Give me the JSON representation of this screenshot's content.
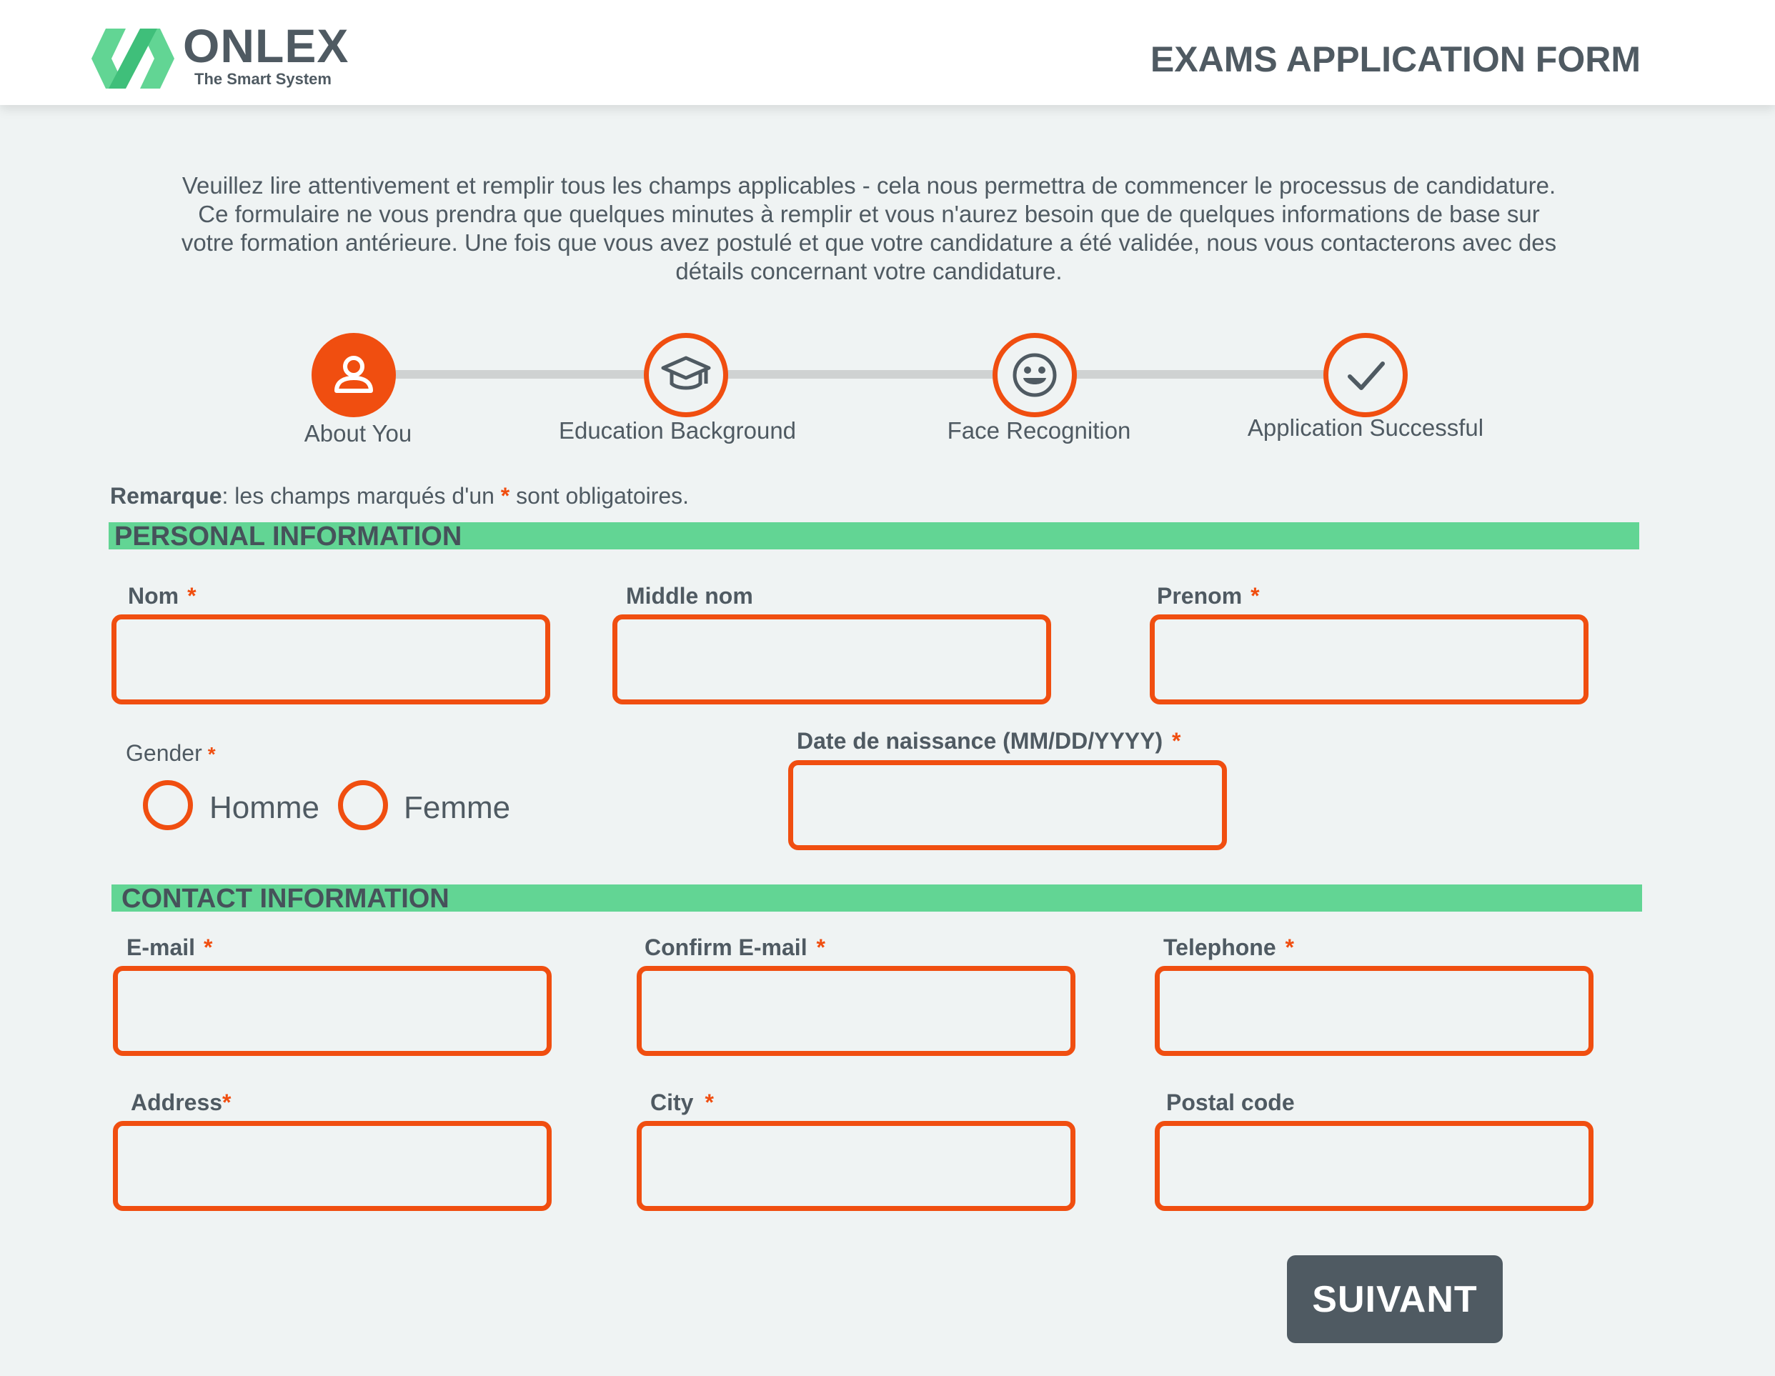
{
  "header": {
    "brand_name": "ONLEX",
    "brand_tagline": "The Smart System",
    "title": "EXAMS APPLICATION FORM"
  },
  "intro_text": "Veuillez lire attentivement et remplir tous les champs applicables - cela nous permettra de commencer le processus de candidature. Ce formulaire ne vous prendra que quelques minutes à remplir et vous n'aurez besoin que de quelques informations de base sur votre formation antérieure. Une fois que vous avez postulé et que votre candidature a été validée, nous vous contacterons avec des détails concernant votre candidature.",
  "steps": [
    {
      "label": "About You",
      "icon": "user-icon",
      "active": true
    },
    {
      "label": "Education Background",
      "icon": "graduation-cap-icon",
      "active": false
    },
    {
      "label": "Face Recognition",
      "icon": "smiley-face-icon",
      "active": false
    },
    {
      "label": "Application Successful",
      "icon": "checkmark-icon",
      "active": false
    }
  ],
  "remark": {
    "bold": "Remarque",
    "before": ": les champs marqués d'un ",
    "star": "*",
    "after": " sont obligatoires."
  },
  "required_mark": "*",
  "personal": {
    "title": "PERSONAL INFORMATION",
    "nom": {
      "label": "Nom",
      "value": ""
    },
    "middle": {
      "label": "Middle nom",
      "value": ""
    },
    "prenom": {
      "label": "Prenom",
      "value": ""
    },
    "gender": {
      "label": "Gender",
      "options": [
        "Homme",
        "Femme"
      ],
      "selected": ""
    },
    "dob": {
      "label": "Date de naissance (MM/DD/YYYY)",
      "value": ""
    }
  },
  "contact": {
    "title": "CONTACT  INFORMATION",
    "email": {
      "label": "E-mail",
      "value": ""
    },
    "confirm_email": {
      "label": "Confirm E-mail",
      "value": ""
    },
    "telephone": {
      "label": "Telephone",
      "value": ""
    },
    "address": {
      "label": "Address",
      "value": ""
    },
    "city": {
      "label": "City",
      "value": ""
    },
    "postal": {
      "label": "Postal code",
      "value": ""
    }
  },
  "submit_label": "SUIVANT",
  "colors": {
    "accent": "#f04e10",
    "section_bar": "#62d594",
    "text": "#4f5a62",
    "logo_green": "#62d594",
    "background": "#eff3f3"
  }
}
